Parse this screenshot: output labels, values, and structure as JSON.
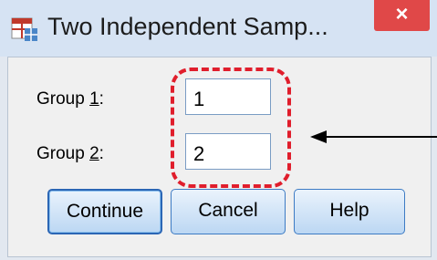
{
  "window": {
    "title": "Two Independent Samp...",
    "close_glyph": "×"
  },
  "form": {
    "group1_label": "Group 1:",
    "group1_underline": "1",
    "group1_value": "1",
    "group2_label": "Group 2:",
    "group2_underline": "2",
    "group2_value": "2"
  },
  "buttons": {
    "continue": "Continue",
    "cancel": "Cancel",
    "help": "Help"
  },
  "icons": {
    "app": "table-icon",
    "close": "close-icon"
  },
  "colors": {
    "highlight": "#e01e2c",
    "close": "#e04848",
    "button_border": "#3d7bc4"
  }
}
